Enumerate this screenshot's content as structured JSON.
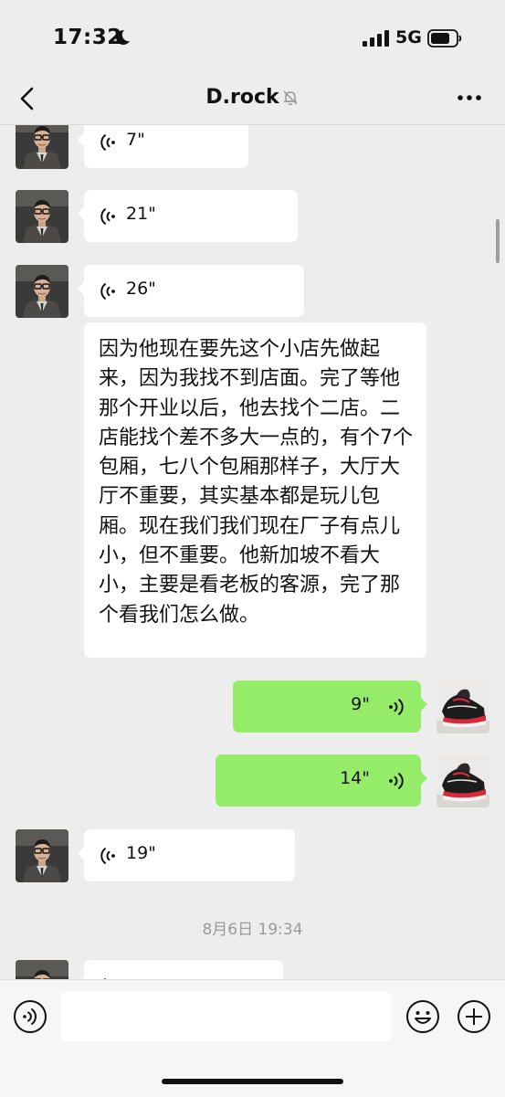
{
  "status_bar": {
    "time": "17:32",
    "network": "5G"
  },
  "header": {
    "title": "D.rock"
  },
  "messages": [
    {
      "side": "left",
      "type": "voice",
      "duration": "7\""
    },
    {
      "side": "left",
      "type": "voice",
      "duration": "21\""
    },
    {
      "side": "left",
      "type": "voice",
      "duration": "26\""
    },
    {
      "side": "left",
      "type": "text",
      "text": "因为他现在要先这个小店先做起来，因为我找不到店面。完了等他那个开业以后，他去找个二店。二店能找个差不多大一点的，有个7个包厢，七八个包厢那样子，大厅大厅不重要，其实基本都是玩儿包厢。现在我们我们现在厂子有点儿小，但不重要。他新加坡不看大小，主要是看老板的客源，完了那个看我们怎么做。"
    },
    {
      "side": "right",
      "type": "voice",
      "duration": "9\""
    },
    {
      "side": "right",
      "type": "voice",
      "duration": "14\""
    },
    {
      "side": "left",
      "type": "voice",
      "duration": "19\""
    }
  ],
  "timestamp": "8月6日 19:34",
  "colors": {
    "background": "#ededed",
    "incoming_bubble": "#ffffff",
    "outgoing_bubble": "#95ec69"
  },
  "icons": {
    "back": "chevron-left-icon",
    "mute": "bell-muted-icon",
    "more": "ellipsis-icon",
    "voice_input": "voice-input-icon",
    "emoji": "emoji-icon",
    "plus": "plus-icon"
  }
}
